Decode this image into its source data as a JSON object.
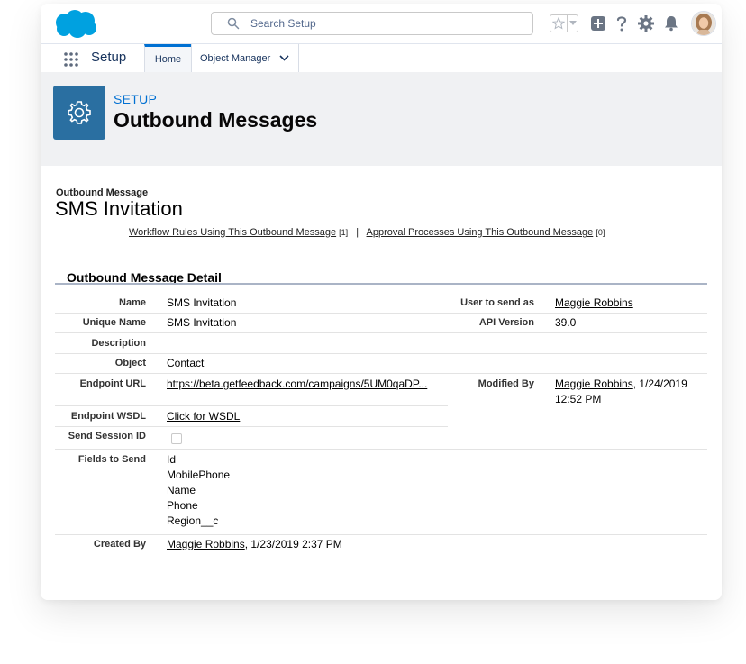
{
  "header": {
    "search_placeholder": "Search Setup",
    "brand_color": "#00A1E0"
  },
  "nav": {
    "app_name": "Setup",
    "tabs": [
      {
        "label": "Home",
        "active": true
      },
      {
        "label": "Object Manager",
        "active": false
      }
    ]
  },
  "page_header": {
    "eyebrow": "SETUP",
    "title": "Outbound Messages"
  },
  "record": {
    "type_label": "Outbound Message",
    "name": "SMS Invitation",
    "related_links": [
      {
        "label": "Workflow Rules Using This Outbound Message",
        "count": "[1]"
      },
      {
        "label": "Approval Processes Using This Outbound Message",
        "count": "[0]"
      }
    ],
    "separator": "|"
  },
  "detail": {
    "section_title": "Outbound Message Detail",
    "fields": {
      "name": {
        "label": "Name",
        "value": "SMS Invitation"
      },
      "unique_name": {
        "label": "Unique Name",
        "value": "SMS Invitation"
      },
      "description": {
        "label": "Description",
        "value": ""
      },
      "object": {
        "label": "Object",
        "value": "Contact"
      },
      "endpoint_url": {
        "label": "Endpoint URL",
        "value": "https://beta.getfeedback.com/campaigns/5UM0qaDP..."
      },
      "endpoint_wsdl": {
        "label": "Endpoint WSDL",
        "value": "Click for WSDL"
      },
      "send_session_id": {
        "label": "Send Session ID",
        "checked": false
      },
      "fields_to_send": {
        "label": "Fields to Send",
        "values": [
          "Id",
          "MobilePhone",
          "Name",
          "Phone",
          "Region__c"
        ]
      },
      "created_by": {
        "label": "Created By",
        "user": "Maggie Robbins",
        "date": ", 1/23/2019 2:37 PM"
      },
      "user_to_send_as": {
        "label": "User to send as",
        "value": "Maggie Robbins"
      },
      "api_version": {
        "label": "API Version",
        "value": "39.0"
      },
      "modified_by": {
        "label": "Modified By",
        "user": "Maggie Robbins",
        "date_line1": ", 1/24/2019",
        "date_line2": "12:52 PM"
      }
    }
  }
}
